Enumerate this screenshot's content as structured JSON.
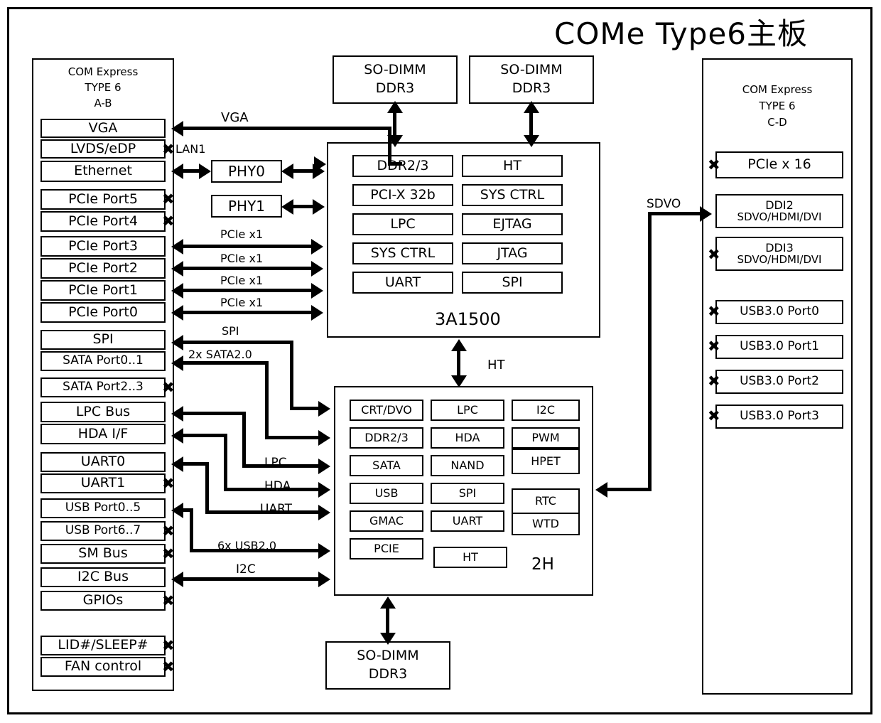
{
  "title": "COMe Type6主板",
  "left_panel": {
    "header": [
      "COM Express",
      "TYPE 6",
      "A-B"
    ],
    "items": [
      {
        "label": "VGA",
        "x": false
      },
      {
        "label": "LVDS/eDP",
        "x": true
      },
      {
        "label": "Ethernet",
        "x": false
      },
      {
        "label": "PCIe Port5",
        "x": true
      },
      {
        "label": "PCIe Port4",
        "x": true
      },
      {
        "label": "PCIe Port3",
        "x": false
      },
      {
        "label": "PCIe Port2",
        "x": false
      },
      {
        "label": "PCIe Port1",
        "x": false
      },
      {
        "label": "PCIe Port0",
        "x": false
      },
      {
        "label": "SPI",
        "x": false
      },
      {
        "label": "SATA Port0..1",
        "x": false
      },
      {
        "label": "SATA Port2..3",
        "x": true
      },
      {
        "label": "LPC Bus",
        "x": false
      },
      {
        "label": "HDA I/F",
        "x": false
      },
      {
        "label": "UART0",
        "x": false
      },
      {
        "label": "UART1",
        "x": true
      },
      {
        "label": "USB Port0..5",
        "x": false
      },
      {
        "label": "USB Port6..7",
        "x": true
      },
      {
        "label": "SM Bus",
        "x": true
      },
      {
        "label": "I2C Bus",
        "x": false
      },
      {
        "label": "GPIOs",
        "x": true
      },
      {
        "label": "LID#/SLEEP#",
        "x": true
      },
      {
        "label": "FAN control",
        "x": true
      }
    ]
  },
  "right_panel": {
    "header": [
      "COM Express",
      "TYPE 6",
      "C-D"
    ],
    "items": [
      {
        "line1": "PCIe x 16",
        "line2": "",
        "x": true
      },
      {
        "line1": "DDI2",
        "line2": "SDVO/HDMI/DVI",
        "x": false
      },
      {
        "line1": "DDI3",
        "line2": "SDVO/HDMI/DVI",
        "x": true
      },
      {
        "line1": "USB3.0 Port0",
        "line2": "",
        "x": true
      },
      {
        "line1": "USB3.0 Port1",
        "line2": "",
        "x": true
      },
      {
        "line1": "USB3.0 Port2",
        "line2": "",
        "x": true
      },
      {
        "line1": "USB3.0 Port3",
        "line2": "",
        "x": true
      }
    ]
  },
  "phys": [
    {
      "name": "PHY0"
    },
    {
      "name": "PHY1"
    }
  ],
  "sodimm": {
    "top_left": {
      "line1": "SO-DIMM",
      "line2": "DDR3"
    },
    "top_right": {
      "line1": "SO-DIMM",
      "line2": "DDR3"
    },
    "bottom": {
      "line1": "SO-DIMM",
      "line2": "DDR3"
    }
  },
  "cpu": {
    "name": "3A1500",
    "left_col": [
      "DDR2/3",
      "PCI-X 32b",
      "LPC",
      "SYS CTRL",
      "UART"
    ],
    "right_col": [
      "HT",
      "SYS CTRL",
      "EJTAG",
      "JTAG",
      "SPI"
    ]
  },
  "southbridge": {
    "name": "2H",
    "col1": [
      "CRT/DVO",
      "DDR2/3",
      "SATA",
      "USB",
      "GMAC",
      "PCIE"
    ],
    "col2": [
      "LPC",
      "HDA",
      "NAND",
      "SPI",
      "UART",
      "HT"
    ],
    "col3": [
      "I2C",
      "PWM",
      "HPET",
      "RTC",
      "WTD"
    ]
  },
  "bus_labels": {
    "vga": "VGA",
    "lan1": "LAN1",
    "pcie1": "PCIe x1",
    "pcie2": "PCIe x1",
    "pcie3": "PCIe x1",
    "pcie4": "PCIe x1",
    "spi": "SPI",
    "sata": "2x SATA2.0",
    "lpc": "LPC",
    "hda": "HDA",
    "uart": "UART",
    "usb": "6x USB2.0",
    "i2c": "I2C",
    "ht_cpu_sb": "HT",
    "sdvo": "SDVO"
  }
}
